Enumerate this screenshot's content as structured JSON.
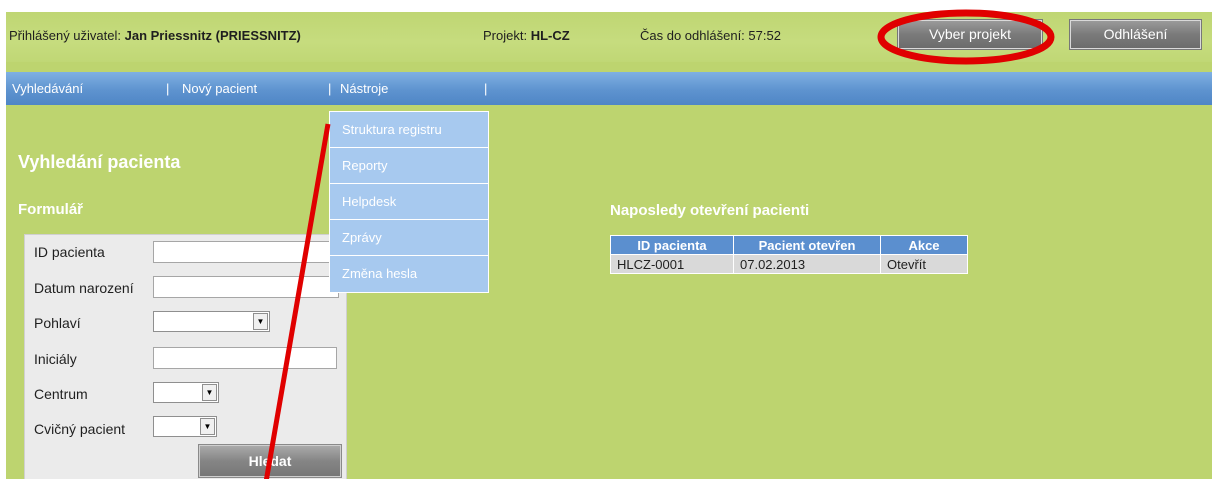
{
  "header": {
    "user_label": "Přihlášený uživatel:",
    "user_name": "Jan Priessnitz (PRIESSNITZ)",
    "project_label": "Projekt:",
    "project_value": "HL-CZ",
    "timeout_label": "Čas do odhlášení:",
    "timeout_value": "57:52",
    "select_project": "Vyber projekt",
    "logout": "Odhlášení"
  },
  "nav": {
    "items": [
      "Vyhledávání",
      "Nový pacient",
      "Nástroje"
    ],
    "separator": "|"
  },
  "tools_menu": {
    "items": [
      "Struktura registru",
      "Reporty",
      "Helpdesk",
      "Zprávy",
      "Změna hesla"
    ]
  },
  "main": {
    "title": "Vyhledání pacienta",
    "form_title": "Formulář",
    "form": {
      "patient_id_label": "ID pacienta",
      "patient_id_value": "",
      "birth_date_label": "Datum narození",
      "birth_date_value": "",
      "sex_label": "Pohlaví",
      "sex_value": "",
      "initials_label": "Iniciály",
      "initials_value": "",
      "center_label": "Centrum",
      "center_value": "",
      "practice_label": "Cvičný pacient",
      "practice_value": "",
      "search_button": "Hledat"
    }
  },
  "recent": {
    "title": "Naposledy otevření pacienti",
    "columns": [
      "ID pacienta",
      "Pacient otevřen",
      "Akce"
    ],
    "rows": [
      [
        "HLCZ-0001",
        "07.02.2013",
        "Otevřít"
      ]
    ]
  },
  "colors": {
    "background": "#bdd46f",
    "nav": "#5e93cf",
    "menu": "#a7c9ef",
    "annotation": "#e00000"
  },
  "icons": {
    "select_arrow": "chevron-down-icon"
  }
}
